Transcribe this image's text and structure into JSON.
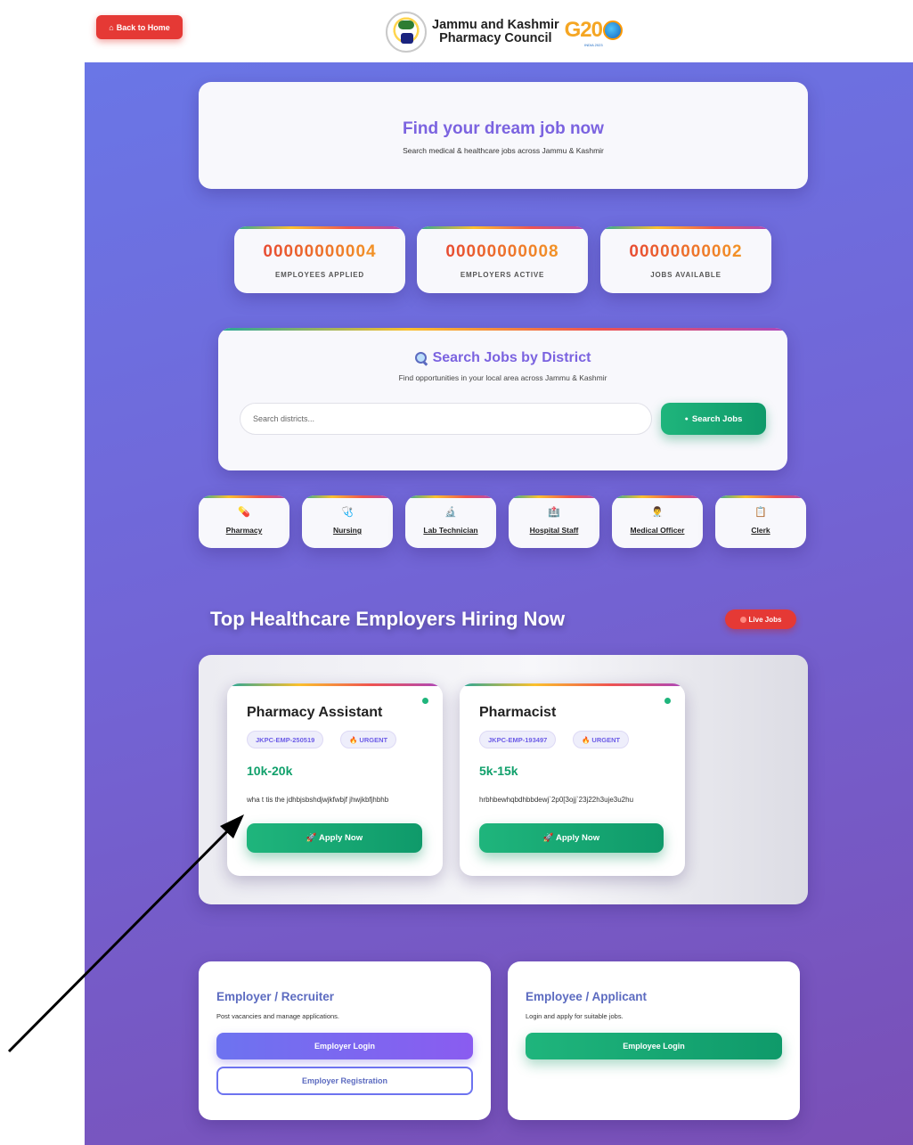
{
  "header": {
    "back_label": "Back to Home",
    "back_icon": "home-icon",
    "council_line1": "Jammu and Kashmir",
    "council_line2": "Pharmacy Council",
    "g20_text": "G20",
    "g20_sub": "INDIA 2023"
  },
  "hero": {
    "title": "Find your dream job now",
    "subtitle": "Search medical & healthcare jobs across Jammu & Kashmir"
  },
  "stats": [
    {
      "value": "00000000004",
      "label": "EMPLOYEES APPLIED"
    },
    {
      "value": "00000000008",
      "label": "EMPLOYERS ACTIVE"
    },
    {
      "value": "00000000002",
      "label": "JOBS AVAILABLE"
    }
  ],
  "search": {
    "title": "Search Jobs by District",
    "subtitle": "Find opportunities in your local area across Jammu & Kashmir",
    "placeholder": "Search districts...",
    "button_label": "Search Jobs"
  },
  "categories": [
    {
      "icon": "💊",
      "label": "Pharmacy"
    },
    {
      "icon": "🩺",
      "label": "Nursing"
    },
    {
      "icon": "🔬",
      "label": "Lab Technician"
    },
    {
      "icon": "🏥",
      "label": "Hospital Staff"
    },
    {
      "icon": "👨‍⚕️",
      "label": "Medical Officer"
    },
    {
      "icon": "📋",
      "label": "Clerk"
    }
  ],
  "employers_section": {
    "title": "Top Healthcare Employers Hiring Now",
    "live_label": "Live Jobs"
  },
  "jobs": [
    {
      "title": "Pharmacy Assistant",
      "id": "JKPC-EMP-250519",
      "tag": "🔥 URGENT",
      "salary": "10k-20k",
      "description": "wha t tis the jdhbjsbshdjwjkfwbjf jhwjkbfjhbhb",
      "apply_label": "🚀 Apply Now"
    },
    {
      "title": "Pharmacist",
      "id": "JKPC-EMP-193497",
      "tag": "🔥 URGENT",
      "salary": "5k-15k",
      "description": "hrbhbewhqbdhbbdewj`2p0[3ojj`23j22h3uje3u2hu",
      "apply_label": "🚀 Apply Now"
    }
  ],
  "employer_panel": {
    "title": "Employer / Recruiter",
    "subtitle": "Post vacancies and manage applications.",
    "login_label": "Employer Login",
    "register_label": "Employer Registration"
  },
  "employee_panel": {
    "title": "Employee / Applicant",
    "subtitle": "Login and apply for suitable jobs.",
    "login_label": "Employee Login"
  },
  "colors": {
    "accent_purple": "#7b63e0",
    "success_green": "#10a06b",
    "danger_red": "#e53935"
  }
}
